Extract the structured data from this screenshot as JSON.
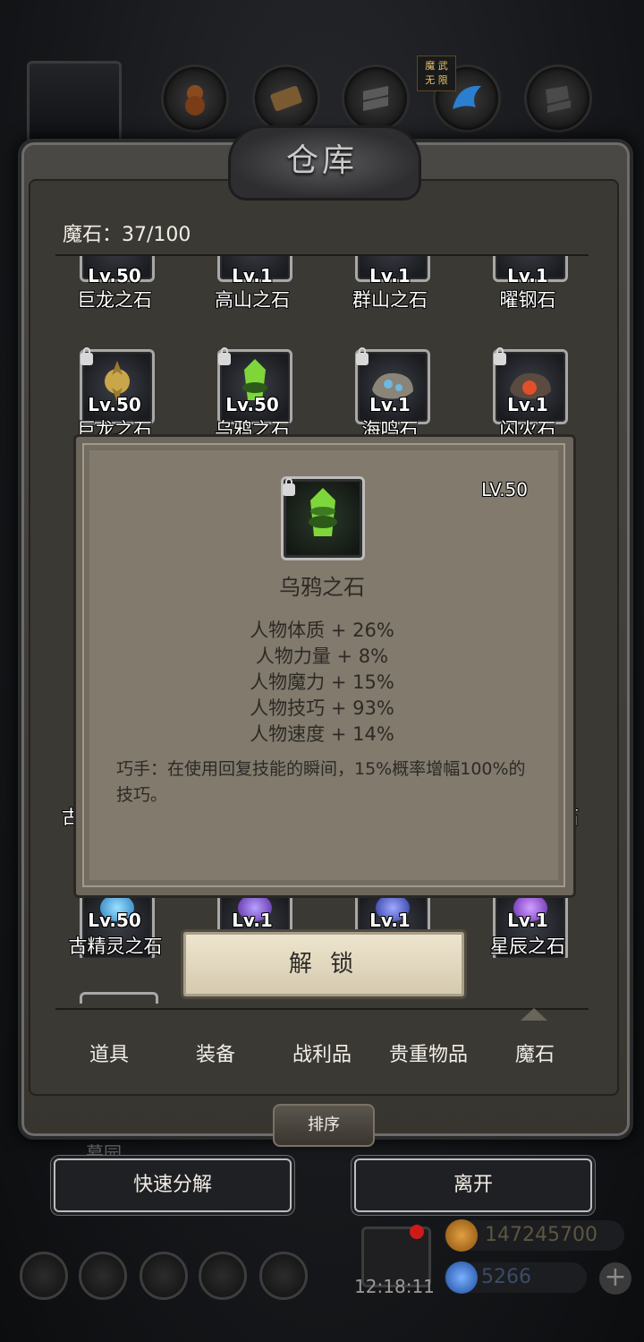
{
  "window": {
    "title": "仓库"
  },
  "header": {
    "badge_line1": "魔 武",
    "badge_line2": "无 限"
  },
  "inventory": {
    "capacity_label": "魔石：37/100",
    "row1": [
      {
        "level": "Lv.50",
        "name": "巨龙之石"
      },
      {
        "level": "Lv.1",
        "name": "高山之石"
      },
      {
        "level": "Lv.1",
        "name": "群山之石"
      },
      {
        "level": "Lv.1",
        "name": "曜钢石"
      }
    ],
    "row2": [
      {
        "level": "Lv.50",
        "name": "巨龙之石"
      },
      {
        "level": "Lv.50",
        "name": "乌鸦之石"
      },
      {
        "level": "Lv.1",
        "name": "海鸣石"
      },
      {
        "level": "Lv.1",
        "name": "闪火石"
      }
    ],
    "row3_partial": {
      "left": "古",
      "right": "石"
    },
    "row4": [
      {
        "level": "Lv.50",
        "name": "古精灵之石"
      },
      {
        "level": "Lv.1",
        "name": ""
      },
      {
        "level": "Lv.1",
        "name": ""
      },
      {
        "level": "Lv.1",
        "name": "星辰之石"
      }
    ]
  },
  "popup": {
    "level": "LV.50",
    "name": "乌鸦之石",
    "stats": [
      "人物体质 + 26%",
      "人物力量 + 8%",
      "人物魔力 + 15%",
      "人物技巧 + 93%",
      "人物速度 + 14%"
    ],
    "description": "巧手：在使用回复技能的瞬间，15%概率增幅100%的技巧。",
    "unlock_label": "解 锁"
  },
  "tabs": [
    {
      "label": "道具"
    },
    {
      "label": "装备"
    },
    {
      "label": "战利品"
    },
    {
      "label": "贵重物品"
    },
    {
      "label": "魔石",
      "active": true
    }
  ],
  "sort_label": "排序",
  "faded_label": "墓园",
  "actions": {
    "quick_decompose": "快速分解",
    "leave": "离开"
  },
  "status": {
    "timer": "12:18:11",
    "gold": "147245700",
    "gems": "5266"
  },
  "colors": {
    "panel": "#817a6d",
    "frame": "#3b3934",
    "text_dark": "#2d2a25",
    "crow_stone": "#7fd63a"
  }
}
